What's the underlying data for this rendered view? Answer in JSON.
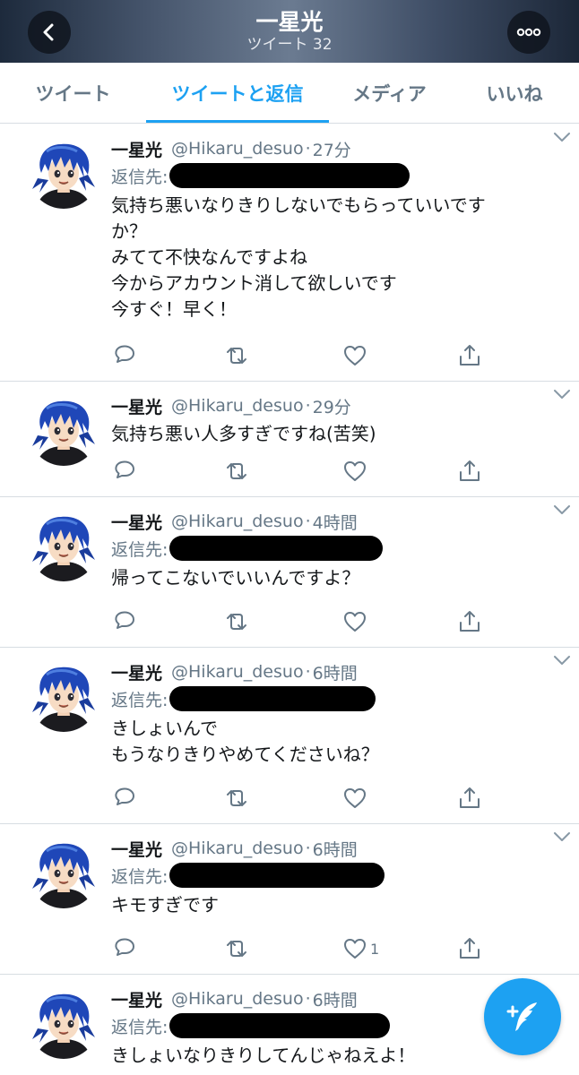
{
  "header": {
    "title": "一星光",
    "subtitle": "ツイート 32"
  },
  "tabs": [
    "ツイート",
    "ツイートと返信",
    "メディア",
    "いいね"
  ],
  "active_tab": 1,
  "accent": "#1da1f2",
  "tweets": [
    {
      "name": "一星光",
      "handle": "@Hikaru_desuo",
      "sep": "·",
      "time": "27分",
      "reply_label": "返信先:",
      "text": "気持ち悪いなりきりしないでもらっていいです\nか？\nみてて不快なんですよね\n今からアカウント消して欲しいです\n今すぐ！早く！",
      "likes": ""
    },
    {
      "name": "一星光",
      "handle": "@Hikaru_desuo",
      "sep": "·",
      "time": "29分",
      "reply_label": "",
      "text": "気持ち悪い人多すぎですね(苦笑)",
      "likes": ""
    },
    {
      "name": "一星光",
      "handle": "@Hikaru_desuo",
      "sep": "·",
      "time": "4時間",
      "reply_label": "返信先:",
      "text": "帰ってこないでいいんですよ？",
      "likes": ""
    },
    {
      "name": "一星光",
      "handle": "@Hikaru_desuo",
      "sep": "·",
      "time": "6時間",
      "reply_label": "返信先:",
      "text": "きしょいんで\nもうなりきりやめてくださいね？",
      "likes": ""
    },
    {
      "name": "一星光",
      "handle": "@Hikaru_desuo",
      "sep": "·",
      "time": "6時間",
      "reply_label": "返信先:",
      "text": "キモすぎです",
      "likes": "1"
    },
    {
      "name": "一星光",
      "handle": "@Hikaru_desuo",
      "sep": "·",
      "time": "6時間",
      "reply_label": "返信先:",
      "text": "きしょいなりきりしてんじゃねえよ！",
      "likes": ""
    }
  ],
  "icons": {
    "back": "chevron-left-icon",
    "more": "more-icon",
    "menu": "chevron-down-icon",
    "reply": "reply-icon",
    "retweet": "retweet-icon",
    "like": "heart-icon",
    "share": "share-icon",
    "compose": "compose-icon"
  }
}
